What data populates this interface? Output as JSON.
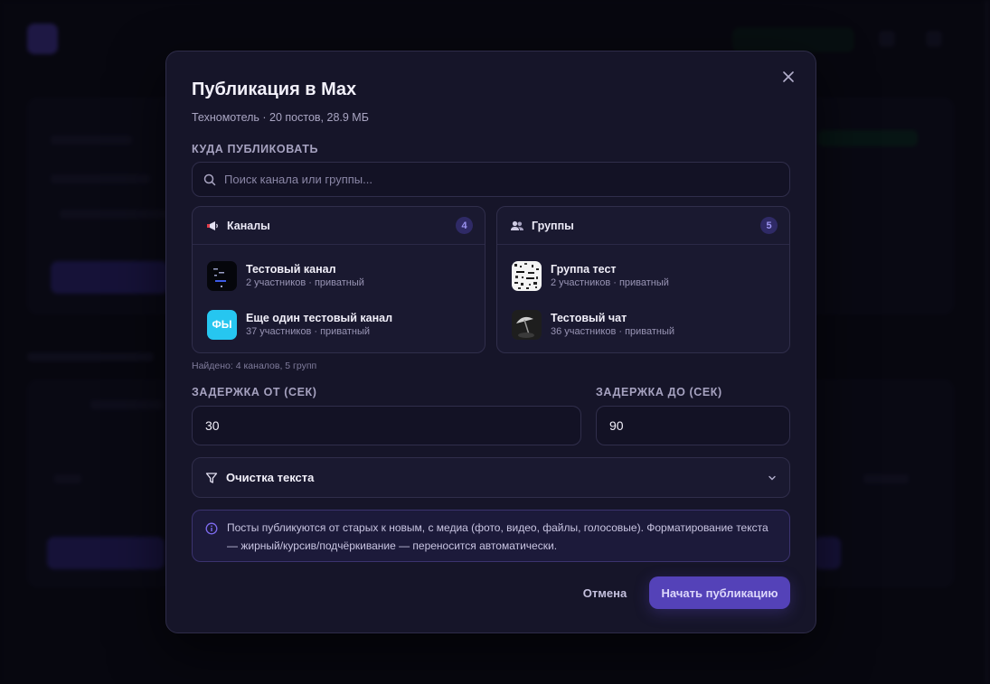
{
  "modal": {
    "title": "Публикация в Max",
    "subtitle": "Техномотель · 20 постов, 28.9 МБ",
    "target_label": "КУДА ПУБЛИКОВАТЬ",
    "search_placeholder": "Поиск канала или группы...",
    "channels": {
      "title": "Каналы",
      "count": "4",
      "items": [
        {
          "name": "Тестовый канал",
          "meta": "2 участников · приватный",
          "avatar_icon": "dark-channel-avatar"
        },
        {
          "name": "Еще один тестовый канал",
          "meta": "37 участников · приватный",
          "avatar_text": "ФЫ",
          "avatar_color": "#26c6f0"
        }
      ]
    },
    "groups": {
      "title": "Группы",
      "count": "5",
      "items": [
        {
          "name": "Группа тест",
          "meta": "2 участников · приватный",
          "avatar_icon": "noise-avatar"
        },
        {
          "name": "Тестовый чат",
          "meta": "36 участников · приватный",
          "avatar_icon": "umbrella-avatar"
        }
      ]
    },
    "found_text": "Найдено: 4 каналов, 5 групп",
    "delay_from": {
      "label": "ЗАДЕРЖКА ОТ (СЕК)",
      "value": "30"
    },
    "delay_to": {
      "label": "ЗАДЕРЖКА ДО (СЕК)",
      "value": "90"
    },
    "text_cleanup_label": "Очистка текста",
    "info_text": "Посты публикуются от старых к новым, с медиа (фото, видео, файлы, голосовые). Форматирование текста — жирный/курсив/подчёркивание — переносится автоматически.",
    "cancel_label": "Отмена",
    "start_label": "Начать публикацию"
  },
  "colors": {
    "accent": "#5442b8",
    "badge_text": "#9c94f2",
    "info_icon": "#7e6cf0"
  }
}
